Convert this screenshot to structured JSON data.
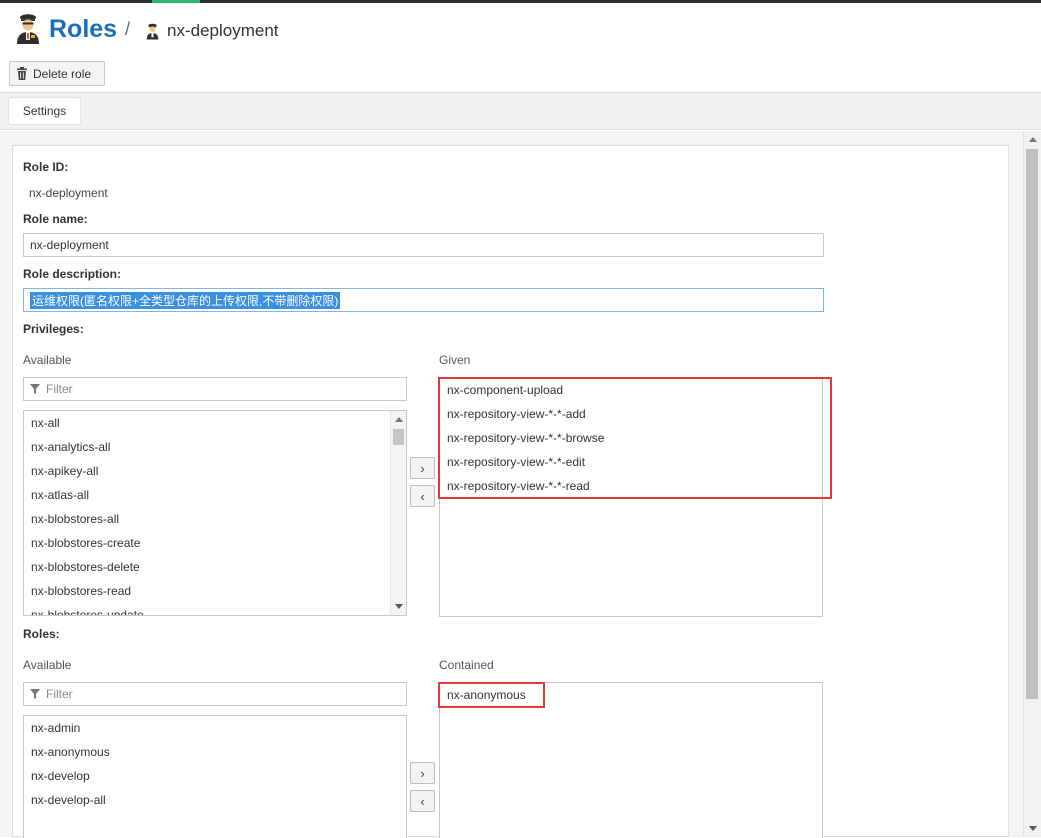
{
  "header": {
    "title": "Roles",
    "separator": "/",
    "subtitle": "nx-deployment"
  },
  "toolbar": {
    "delete_label": "Delete role"
  },
  "tabs": [
    {
      "label": "Settings"
    }
  ],
  "form": {
    "role_id_label": "Role ID:",
    "role_id_value": "nx-deployment",
    "role_name_label": "Role name:",
    "role_name_value": "nx-deployment",
    "role_description_label": "Role description:",
    "role_description_value": "运维权限(匿名权限+全类型仓库的上传权限,不带删除权限)"
  },
  "privileges": {
    "label": "Privileges:",
    "available_label": "Available",
    "given_label": "Given",
    "filter_placeholder": "Filter",
    "available": [
      "nx-all",
      "nx-analytics-all",
      "nx-apikey-all",
      "nx-atlas-all",
      "nx-blobstores-all",
      "nx-blobstores-create",
      "nx-blobstores-delete",
      "nx-blobstores-read",
      "nx-blobstores-update"
    ],
    "given": [
      "nx-component-upload",
      "nx-repository-view-*-*-add",
      "nx-repository-view-*-*-browse",
      "nx-repository-view-*-*-edit",
      "nx-repository-view-*-*-read"
    ],
    "add_label": "›",
    "remove_label": "‹"
  },
  "roles": {
    "label": "Roles:",
    "available_label": "Available",
    "contained_label": "Contained",
    "filter_placeholder": "Filter",
    "available": [
      "nx-admin",
      "nx-anonymous",
      "nx-develop",
      "nx-develop-all"
    ],
    "contained": [
      "nx-anonymous"
    ],
    "add_label": "›",
    "remove_label": "‹"
  },
  "icons": {
    "header": "role-user-icon",
    "subtitle": "role-user-icon",
    "delete": "trash-icon",
    "filter": "filter-icon"
  },
  "colors": {
    "title": "#1a6fb5",
    "highlight": "#e0383b",
    "selection": "#3a8fe0"
  }
}
